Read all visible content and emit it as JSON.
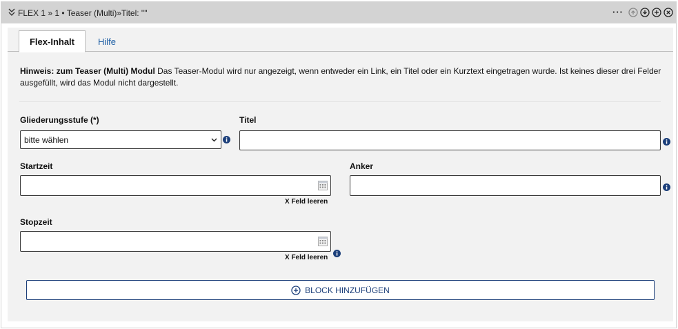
{
  "header": {
    "title": "FLEX 1 »  1 • Teaser (Multi)»Titel: \"\"",
    "menu_label": "···"
  },
  "tabs": [
    {
      "label": "Flex-Inhalt",
      "active": true
    },
    {
      "label": "Hilfe",
      "active": false
    }
  ],
  "hint": {
    "bold": "Hinweis: zum Teaser (Multi) Modul",
    "text": " Das Teaser-Modul wird nur angezeigt, wenn entweder ein Link, ein Titel oder ein Kurztext eingetragen wurde. Ist keines dieser drei Felder ausgefüllt, wird das Modul nicht dargestellt."
  },
  "form": {
    "gliederung": {
      "label": "Gliederungsstufe (*)",
      "value": "bitte wählen"
    },
    "titel": {
      "label": "Titel",
      "value": ""
    },
    "startzeit": {
      "label": "Startzeit",
      "value": "",
      "clear": "X Feld leeren"
    },
    "anker": {
      "label": "Anker",
      "value": ""
    },
    "stopzeit": {
      "label": "Stopzeit",
      "value": "",
      "clear": "X Feld leeren"
    }
  },
  "add_block": {
    "label": "BLOCK HINZUFÜGEN"
  },
  "colors": {
    "link": "#1a5ca3",
    "info": "#1c3f7a",
    "header": "#d3d3d3",
    "panel": "#f2f2f2"
  }
}
